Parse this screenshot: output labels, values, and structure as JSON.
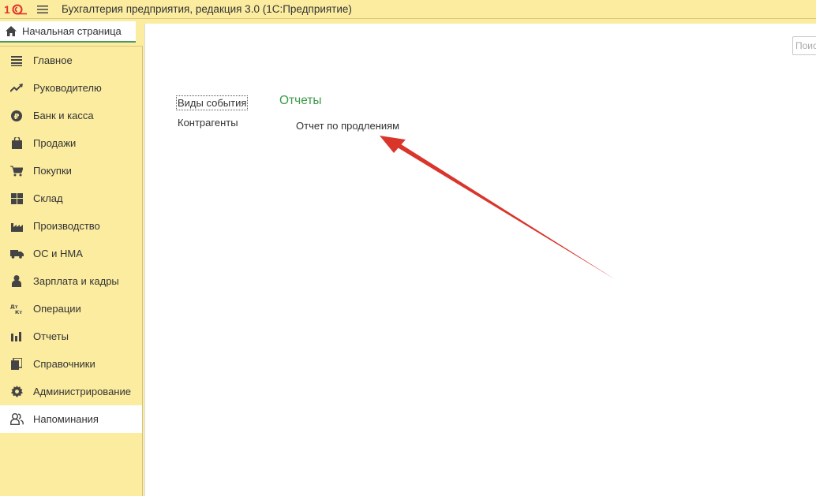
{
  "app": {
    "title": "Бухгалтерия предприятия, редакция 3.0  (1С:Предприятие)",
    "logo_text": "1С"
  },
  "home_tab": {
    "label": "Начальная страница"
  },
  "sidebar": {
    "items": [
      {
        "label": "Главное",
        "icon": "list-icon"
      },
      {
        "label": "Руководителю",
        "icon": "trend-icon"
      },
      {
        "label": "Банк и касса",
        "icon": "ruble-icon"
      },
      {
        "label": "Продажи",
        "icon": "bag-icon"
      },
      {
        "label": "Покупки",
        "icon": "cart-icon"
      },
      {
        "label": "Склад",
        "icon": "warehouse-icon"
      },
      {
        "label": "Производство",
        "icon": "factory-icon"
      },
      {
        "label": "ОС и НМА",
        "icon": "truck-icon"
      },
      {
        "label": "Зарплата и кадры",
        "icon": "person-icon"
      },
      {
        "label": "Операции",
        "icon": "dt-kt-icon"
      },
      {
        "label": "Отчеты",
        "icon": "bar-chart-icon"
      },
      {
        "label": "Справочники",
        "icon": "books-icon"
      },
      {
        "label": "Администрирование",
        "icon": "gear-icon"
      },
      {
        "label": "Напоминания",
        "icon": "people-icon",
        "active": true
      }
    ]
  },
  "search": {
    "placeholder": "Поис"
  },
  "content": {
    "nav_links": [
      "Виды события",
      "Контрагенты"
    ],
    "section_title": "Отчеты",
    "reports": [
      "Отчет по продлениям"
    ]
  },
  "colors": {
    "accent_green": "#3c9a4a",
    "sidebar_bg": "#fbeca0",
    "arrow_red": "#d9352b",
    "logo_red": "#e2322a"
  }
}
